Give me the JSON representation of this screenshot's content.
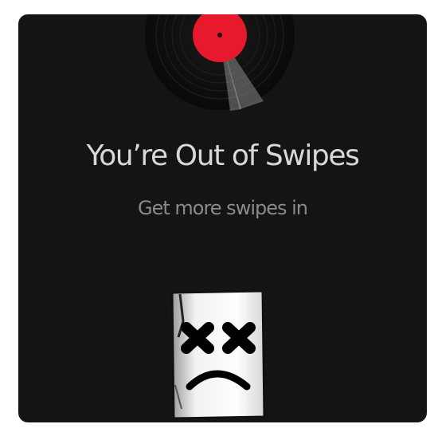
{
  "modal": {
    "title": "You’re Out of Swipes",
    "subtitle": "Get more swipes in"
  },
  "icons": {
    "record": "vinyl-record-icon",
    "mascot": "sad-marshmallow-mascot-icon"
  },
  "colors": {
    "background": "#141414",
    "label_red": "#e8192c",
    "title_text": "#d8d8d8",
    "subtitle_text": "#8a8a8a"
  }
}
